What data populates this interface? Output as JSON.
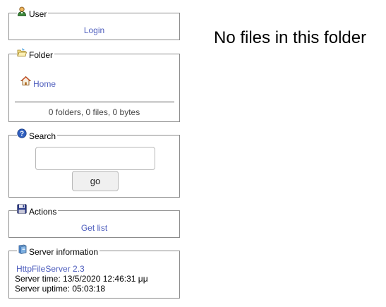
{
  "user_panel": {
    "title": "User",
    "login_label": "Login"
  },
  "folder_panel": {
    "title": "Folder",
    "home_label": "Home",
    "stats": "0 folders, 0 files, 0 bytes"
  },
  "search_panel": {
    "title": "Search",
    "query": "",
    "go_label": "go"
  },
  "actions_panel": {
    "title": "Actions",
    "get_list_label": "Get list"
  },
  "server_panel": {
    "title": "Server information",
    "version_link": "HttpFileServer 2.3",
    "server_time": "Server time: 13/5/2020 12:46:31 μμ",
    "server_uptime": "Server uptime: 05:03:18"
  },
  "main": {
    "empty_message": "No files in this folder"
  },
  "colors": {
    "link": "#4d5dbd",
    "border": "#8c8c8c"
  },
  "icons": {
    "user": "user-icon",
    "folder": "folder-icon",
    "home": "home-icon",
    "search": "help-icon",
    "actions": "floppy-disk-icon",
    "server": "server-icon"
  }
}
